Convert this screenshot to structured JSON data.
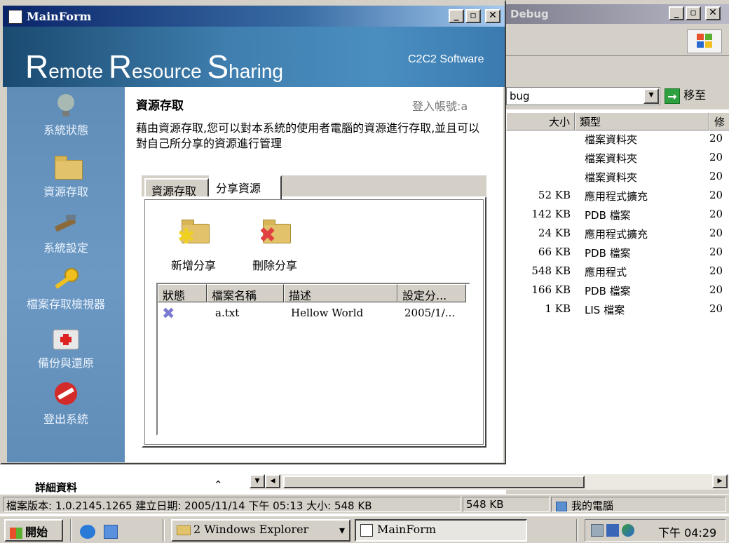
{
  "explorer": {
    "title": "Debug",
    "address_value": "bug",
    "go_label": "移至",
    "columns": [
      "大小",
      "類型",
      "修"
    ],
    "files": [
      {
        "size": "",
        "type": "檔案資料夾",
        "date": "20"
      },
      {
        "size": "",
        "type": "檔案資料夾",
        "date": "20"
      },
      {
        "size": "",
        "type": "檔案資料夾",
        "date": "20"
      },
      {
        "size": "52 KB",
        "type": "應用程式擴充",
        "date": "20"
      },
      {
        "size": "142 KB",
        "type": "PDB 檔案",
        "date": "20"
      },
      {
        "size": "24 KB",
        "type": "應用程式擴充",
        "date": "20"
      },
      {
        "size": "66 KB",
        "type": "PDB 檔案",
        "date": "20"
      },
      {
        "size": "548 KB",
        "type": "應用程式",
        "date": "20"
      },
      {
        "size": "166 KB",
        "type": "PDB 檔案",
        "date": "20"
      },
      {
        "size": "1 KB",
        "type": "LIS 檔案",
        "date": "20"
      }
    ]
  },
  "details": {
    "title": "詳細資料",
    "chevron": "⌃"
  },
  "statusbar": {
    "info": "檔案版本: 1.0.2145.1265 建立日期: 2005/11/14 下午 05:13 大小: 548 KB",
    "size": "548 KB",
    "location": "我的電腦"
  },
  "taskbar": {
    "start_label": "開始",
    "explorer_group": "2 Windows Explorer",
    "mainform_task": "MainForm",
    "clock": "下午 04:29"
  },
  "mainform": {
    "title": "MainForm",
    "banner": {
      "r1": "R",
      "t1": "emote ",
      "r2": "R",
      "t2": "esource ",
      "r3": "S",
      "t3": "haring",
      "brand": "C2C2 Software"
    },
    "nav": [
      {
        "label": "系統狀態",
        "icon": "lightbulb-icon"
      },
      {
        "label": "資源存取",
        "icon": "folder-icon"
      },
      {
        "label": "系統設定",
        "icon": "tools-icon"
      },
      {
        "label": "檔案存取檢視器",
        "icon": "key-icon"
      },
      {
        "label": "備份與還原",
        "icon": "first-aid-icon"
      },
      {
        "label": "登出系統",
        "icon": "stop-icon"
      }
    ],
    "content": {
      "title": "資源存取",
      "login": "登入帳號:a",
      "description": "藉由資源存取,您可以對本系統的使用者電腦的資源進行存取,並且可以對自己所分享的資源進行管理",
      "tabs": [
        "資源存取",
        "分享資源"
      ],
      "actions": {
        "add": "新增分享",
        "remove": "刪除分享"
      },
      "list_columns": [
        "狀態",
        "檔案名稱",
        "描述",
        "設定分..."
      ],
      "rows": [
        {
          "status_icon": "x-status-icon",
          "filename": "a.txt",
          "description": "Hellow World",
          "date": "2005/1/..."
        }
      ]
    }
  }
}
